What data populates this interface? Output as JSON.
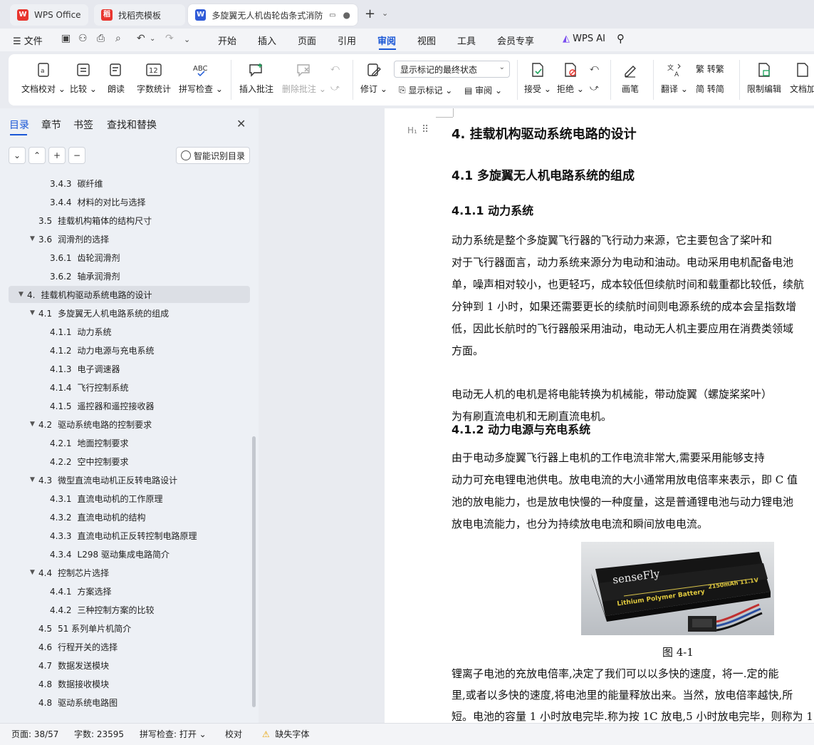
{
  "tabs": [
    {
      "label": "WPS Office",
      "icon": "wps-logo-icon"
    },
    {
      "label": "找稻壳模板",
      "icon": "docer-icon"
    },
    {
      "label": "多旋翼无人机齿轮齿条式消防",
      "icon": "word-doc-icon"
    }
  ],
  "menu": {
    "file": "文件",
    "items": [
      "开始",
      "插入",
      "页面",
      "引用",
      "审阅",
      "视图",
      "工具",
      "会员专享"
    ],
    "active": "审阅",
    "ai": "WPS AI"
  },
  "ribbon": {
    "doc_check": "文档校对",
    "compare": "比较",
    "read_aloud": "朗读",
    "word_count": "字数统计",
    "spell_check": "拼写检查",
    "insert_comment": "插入批注",
    "delete_comment": "删除批注",
    "revise": "修订",
    "markup_select": "显示标记的最终状态",
    "show_markup": "显示标记",
    "review": "审阅",
    "accept": "接受",
    "reject": "拒绝",
    "pen": "画笔",
    "translate": "翻译",
    "to_traditional": "转繁",
    "to_simplified": "转简",
    "restrict_edit": "限制编辑",
    "doc_encrypt": "文档加"
  },
  "panel": {
    "tabs": [
      "目录",
      "章节",
      "书签",
      "查找和替换"
    ],
    "smart_toc": "智能识别目录",
    "toc": [
      {
        "num": "3.4.3",
        "text": "碳纤维",
        "level": 3
      },
      {
        "num": "3.4.4",
        "text": "材料的对比与选择",
        "level": 3
      },
      {
        "num": "3.5",
        "text": "挂载机构箱体的结构尺寸",
        "level": 2
      },
      {
        "num": "3.6",
        "text": "润滑剂的选择",
        "level": 2,
        "expand": true
      },
      {
        "num": "3.6.1",
        "text": "齿轮润滑剂",
        "level": 3
      },
      {
        "num": "3.6.2",
        "text": "轴承润滑剂",
        "level": 3
      },
      {
        "num": "4.",
        "text": "挂载机构驱动系统电路的设计",
        "level": 1,
        "expand": true,
        "selected": true
      },
      {
        "num": "4.1",
        "text": "多旋翼无人机电路系统的组成",
        "level": 2,
        "expand": true
      },
      {
        "num": "4.1.1",
        "text": "动力系统",
        "level": 3
      },
      {
        "num": "4.1.2",
        "text": "动力电源与充电系统",
        "level": 3
      },
      {
        "num": "4.1.3",
        "text": "电子调速器",
        "level": 3
      },
      {
        "num": "4.1.4",
        "text": "飞行控制系统",
        "level": 3
      },
      {
        "num": "4.1.5",
        "text": "遥控器和遥控接收器",
        "level": 3
      },
      {
        "num": "4.2",
        "text": "驱动系统电路的控制要求",
        "level": 2,
        "expand": true
      },
      {
        "num": "4.2.1",
        "text": "地面控制要求",
        "level": 3
      },
      {
        "num": "4.2.2",
        "text": "空中控制要求",
        "level": 3
      },
      {
        "num": "4.3",
        "text": "微型直流电动机正反转电路设计",
        "level": 2,
        "expand": true
      },
      {
        "num": "4.3.1",
        "text": "直流电动机的工作原理",
        "level": 3
      },
      {
        "num": "4.3.2",
        "text": "直流电动机的结构",
        "level": 3
      },
      {
        "num": "4.3.3",
        "text": "直流电动机正反转控制电路原理",
        "level": 3
      },
      {
        "num": "4.3.4",
        "text": "L298 驱动集成电路简介",
        "level": 3
      },
      {
        "num": "4.4",
        "text": "控制芯片选择",
        "level": 2,
        "expand": true
      },
      {
        "num": "4.4.1",
        "text": "方案选择",
        "level": 3
      },
      {
        "num": "4.4.2",
        "text": "三种控制方案的比较",
        "level": 3
      },
      {
        "num": "4.5",
        "text": "51 系列单片机简介",
        "level": 2
      },
      {
        "num": "4.6",
        "text": "行程开关的选择",
        "level": 2
      },
      {
        "num": "4.7",
        "text": "数据发送模块",
        "level": 2
      },
      {
        "num": "4.8",
        "text": "数据接收模块",
        "level": 2
      },
      {
        "num": "4.8",
        "text": "驱动系统电路图",
        "level": 2
      }
    ]
  },
  "doc": {
    "h1": "4.   挂载机构驱动系统电路的设计",
    "h2": "4.1    多旋翼无人机电路系统的组成",
    "h3a": "4.1.1    动力系统",
    "para1": [
      "        动力系统是整个多旋翼飞行器的飞行动力来源，它主要包含了桨叶和",
      "对于飞行器面言，动力系统来源分为电动和油动。电动采用电机配备电池",
      "单，噪声相对较小，也更轻巧，成本较低但续航时间和载重都比较低，续航",
      "分钟到 1 小时，如果还需要更长的续航时间则电源系统的成本会呈指数增",
      "低，因此长航时的飞行器般采用油动，电动无人机主要应用在消费类领域",
      "方面。"
    ],
    "para2": [
      "        电动无人机的电机是将电能转换为机械能，带动旋翼（螺旋桨桨叶）",
      "为有刷直流电机和无刷直流电机。"
    ],
    "h3b": "4.1.2    动力电源与充电系统",
    "para3": [
      "        由于电动多旋翼飞行器上电机的工作电流非常大,需要采用能够支持",
      "动力可充电锂电池供电。放电电流的大小通常用放电倍率来表示，即 C 值",
      "池的放电能力，也是放电快慢的一种度量，这是普通锂电池与动力锂电池",
      "放电电流能力，也分为持续放电电流和瞬间放电电流。"
    ],
    "figure": {
      "brand": "senseFly",
      "label": "Lithium Polymer Battery",
      "rating": "2150mAh 11.1V"
    },
    "caption": "图 4-1",
    "para4": [
      "      锂离子电池的充放电倍率,决定了我们可以以多快的速度，将一.定的能",
      "里,或者以多快的速度,将电池里的能量释放出来。当然，放电倍率越快,所",
      "短。电池的容量 1 小时放电完毕.称为按 1C 放电,5 小时放电完毕，则称为 1"
    ]
  },
  "status": {
    "page": "页面: 38/57",
    "words": "字数: 23595",
    "spell": "拼写检查: 打开",
    "proof": "校对",
    "missing_font": "缺失字体"
  },
  "colors": {
    "accent": "#1a57d6",
    "wps_red": "#e8352e",
    "word_blue": "#2f5bd8"
  }
}
